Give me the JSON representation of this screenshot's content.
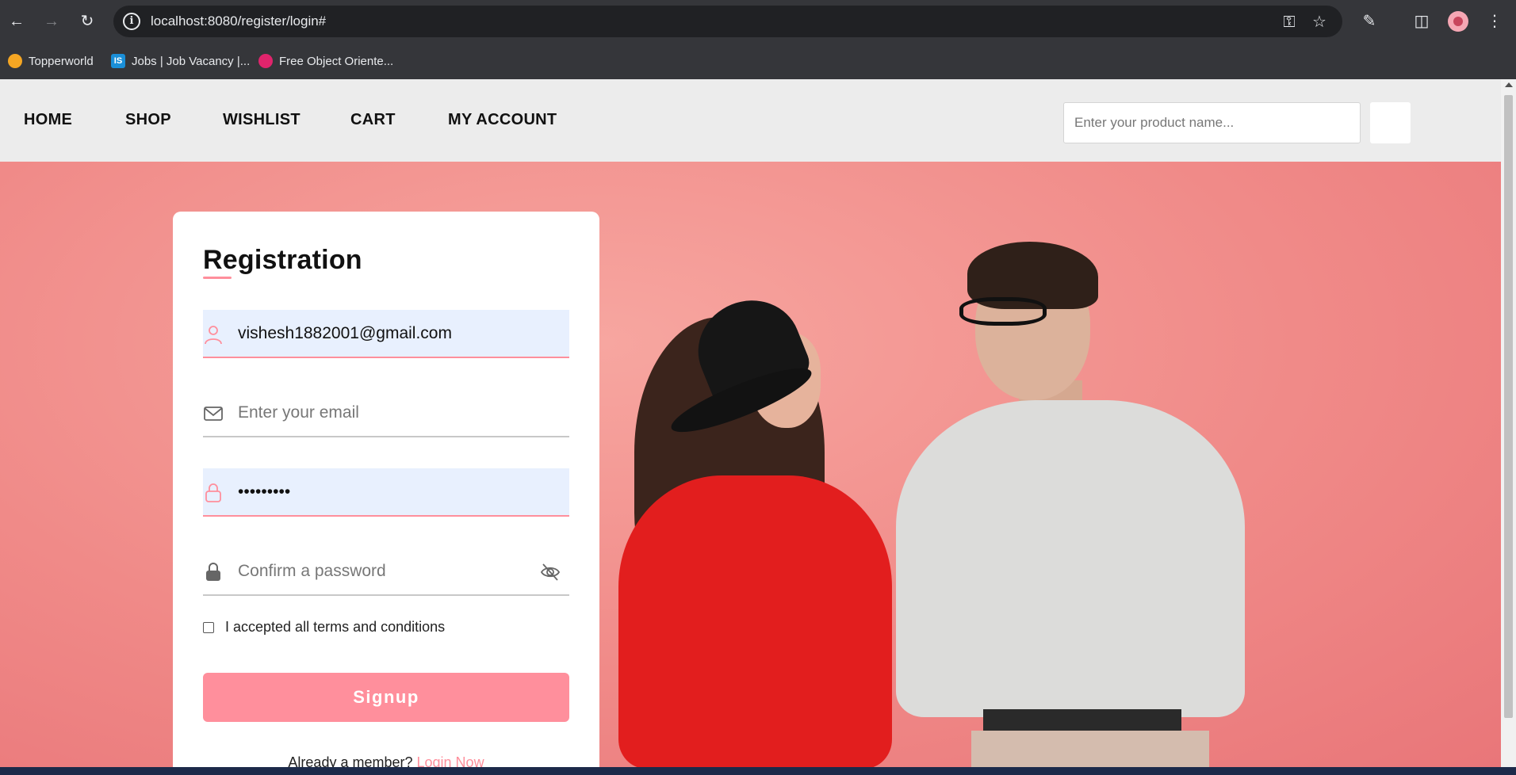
{
  "browser": {
    "url": "localhost:8080/register/login#",
    "bookmarks": [
      {
        "label": "Topperworld",
        "icon": "topperworld-icon"
      },
      {
        "label": "Jobs | Job Vacancy |...",
        "icon": "is-icon",
        "badge": "IS"
      },
      {
        "label": "Free Object Oriente...",
        "icon": "free-object-icon"
      }
    ]
  },
  "nav": {
    "links": [
      "HOME",
      "SHOP",
      "WISHLIST",
      "CART",
      "MY ACCOUNT"
    ],
    "search_placeholder": "Enter your product name..."
  },
  "form": {
    "title": "Registration",
    "name_value": "vishesh1882001@gmail.com",
    "email_placeholder": "Enter your email",
    "password_value": "•••••••••",
    "confirm_placeholder": "Confirm a password",
    "terms_label": "I accepted all terms and conditions",
    "signup_label": "Signup",
    "member_text": "Already a member?",
    "login_link": "Login Now"
  },
  "colors": {
    "accent": "#ff8f9c",
    "hero_bg": "#f18f8d",
    "autofill_bg": "#e8f0fe"
  }
}
